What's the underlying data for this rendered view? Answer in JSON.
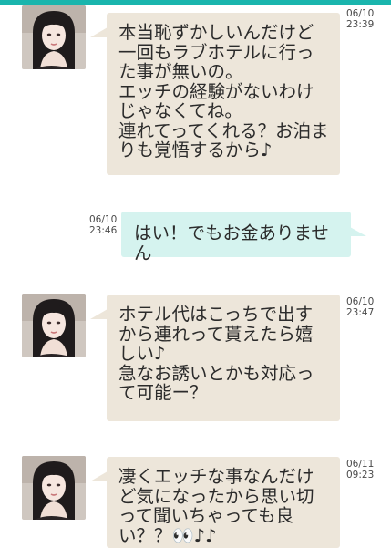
{
  "theme": {
    "top_bar_color": "#1ab5ad",
    "incoming_bubble_color": "#ede6da",
    "outgoing_bubble_color": "#d5f3ef"
  },
  "messages": [
    {
      "direction": "incoming",
      "avatar_icon": "profile-photo-woman",
      "date": "06/10",
      "time": "23:39",
      "text": "本当恥ずかしいんだけど一回もラブホテルに行った事が無いの。\nエッチの経験がないわけじゃなくてね。\n連れてってくれる？お泊まりも覚悟するから♪"
    },
    {
      "direction": "outgoing",
      "date": "06/10",
      "time": "23:46",
      "text": "はい！でもお金ありません"
    },
    {
      "direction": "incoming",
      "avatar_icon": "profile-photo-woman",
      "date": "06/10",
      "time": "23:47",
      "text": "ホテル代はこっちで出すから連れって貰えたら嬉しい♪\n急なお誘いとかも対応って可能ー？"
    },
    {
      "direction": "incoming",
      "avatar_icon": "profile-photo-woman",
      "date": "06/11",
      "time": "09:23",
      "text": "凄くエッチな事なんだけど気になったから思い切って聞いちゃっても良い？？👀♪♪"
    }
  ]
}
